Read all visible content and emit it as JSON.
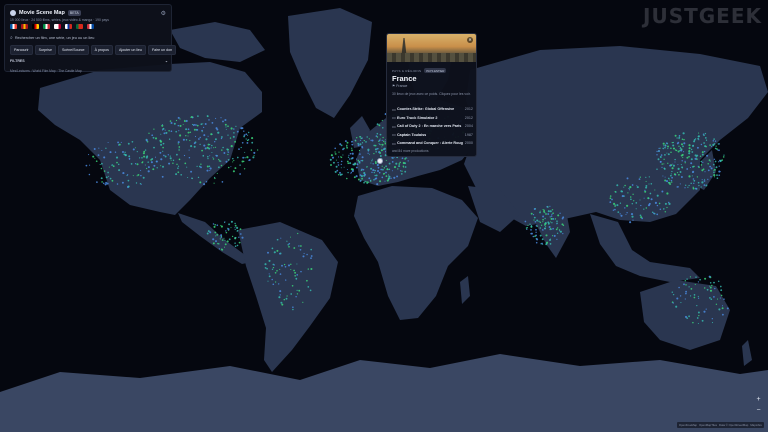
{
  "watermark": "JUSTGEEK",
  "app": {
    "title": "Movie Scene Map",
    "badge": "BETA",
    "subtitle": "19 000 lieux · 24 500 films, séries, jeux vidéo & manga · 190 pays",
    "search_placeholder": "Rechercher un film, une série, un jeu ou un lieu",
    "buttons": [
      "Parcourir",
      "Surprise",
      "Scène/Source",
      "À propos",
      "Ajouter un lieu",
      "Faire un don"
    ],
    "filters_label": "FILTRES",
    "sources": "Mes/Lectures : World Film Map · The Castle Map",
    "flags": [
      {
        "colors": [
          "#0055a4",
          "#ffffff",
          "#ef4135"
        ]
      },
      {
        "colors": [
          "#aa151b",
          "#f1bf00",
          "#aa151b"
        ]
      },
      {
        "colors": [
          "#000000",
          "#dd0000",
          "#ffce00"
        ]
      },
      {
        "colors": [
          "#009246",
          "#ffffff",
          "#ce2b37"
        ]
      },
      {
        "colors": [
          "#ffffff",
          "#ffffff",
          "#bc002d"
        ]
      },
      {
        "colors": [
          "#ffffff",
          "#0039a6",
          "#d52b1e"
        ]
      },
      {
        "colors": [
          "#046a38",
          "#da291c",
          "#da291c"
        ]
      },
      {
        "colors": [
          "#cd2e3a",
          "#ffffff",
          "#0047a0"
        ]
      }
    ]
  },
  "popup": {
    "kicker": "PAYS & RÉGIONS",
    "badge": "PAYS ENTIER",
    "country": "France",
    "country_sub": "France",
    "description": "30 lieux de jeux avec ce poids. Cliquez pour les voir.",
    "items": [
      {
        "title": "Counter-Strike: Global Offensive",
        "year": "2012"
      },
      {
        "title": "Euro Truck Simulator 2",
        "year": "2012"
      },
      {
        "title": "Call of Duty 2 : En marche vers Paris",
        "year": "2004"
      },
      {
        "title": "Captain Toulaiss",
        "year": "1987"
      },
      {
        "title": "Command and Conquer : Alerte Rouge",
        "year": "2000"
      }
    ],
    "more": "and 84 more productions"
  },
  "zoom": {
    "in": "+",
    "out": "−"
  },
  "attribution": [
    "OpenFreeMap",
    "OpenMapTiles",
    "Data © OpenStreetMap",
    "MapLibre"
  ],
  "colors": {
    "ocean": "#05070f",
    "land": "#2a3650",
    "ice": "#3a4763",
    "dot_green": "#3ad67a",
    "dot_teal": "#35b7ae",
    "dot_blue": "#4a8be0"
  }
}
